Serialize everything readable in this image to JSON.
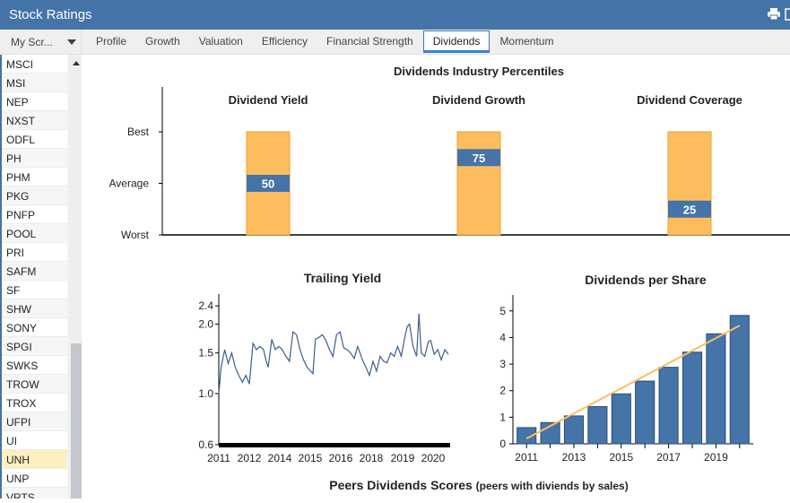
{
  "header": {
    "title": "Stock Ratings",
    "icons": [
      "print-icon",
      "window-icon"
    ]
  },
  "selector": {
    "label": "My Scr...",
    "icon": "chevron-down-icon"
  },
  "tabs": [
    {
      "label": "Profile",
      "active": false
    },
    {
      "label": "Growth",
      "active": false
    },
    {
      "label": "Valuation",
      "active": false
    },
    {
      "label": "Efficiency",
      "active": false
    },
    {
      "label": "Financial Strength",
      "active": false
    },
    {
      "label": "Dividends",
      "active": true
    },
    {
      "label": "Momentum",
      "active": false
    }
  ],
  "sidebar": {
    "items": [
      "MSCI",
      "MSI",
      "NEP",
      "NXST",
      "ODFL",
      "PH",
      "PHM",
      "PKG",
      "PNFP",
      "POOL",
      "PRI",
      "SAFM",
      "SF",
      "SHW",
      "SONY",
      "SPGI",
      "SWKS",
      "TROW",
      "TROX",
      "UFPI",
      "UI",
      "UNH",
      "UNP",
      "VRTS"
    ],
    "selected": "UNH"
  },
  "colors": {
    "brand": "#4474a8",
    "bar_fill": "#fdbd5f",
    "bar_border": "#f0a020",
    "marker": "#4474a8",
    "selected_row": "#fdf0c0",
    "trend": "#fdbd5f"
  },
  "footer": {
    "title": "Peers Dividends Scores",
    "subtitle": "(peers with diviends by sales)"
  },
  "chart_data": [
    {
      "type": "bar",
      "title": "Dividends Industry Percentiles",
      "categories": [
        "Dividend Yield",
        "Dividend Growth",
        "Dividend Coverage"
      ],
      "values": [
        50,
        75,
        25
      ],
      "yticks": [
        "Worst",
        "Average",
        "Best"
      ],
      "ylim": [
        0,
        100
      ]
    },
    {
      "type": "line",
      "title": "Trailing Yield",
      "xlabels": [
        "2011",
        "2012",
        "2014",
        "2015",
        "2016",
        "2018",
        "2019",
        "2020"
      ],
      "yticks": [
        0.6,
        1.0,
        1.5,
        2.0,
        2.4
      ],
      "ylim": [
        0.6,
        2.7
      ],
      "x": [
        2011.0,
        2011.1,
        2011.25,
        2011.4,
        2011.55,
        2011.7,
        2011.85,
        2012.0,
        2012.15,
        2012.3,
        2012.45,
        2012.6,
        2012.75,
        2012.9,
        2013.0,
        2013.1,
        2013.25,
        2013.4,
        2013.55,
        2013.7,
        2013.85,
        2014.0,
        2014.15,
        2014.3,
        2014.45,
        2014.6,
        2014.75,
        2014.9,
        2015.0,
        2015.1,
        2015.25,
        2015.4,
        2015.55,
        2015.7,
        2015.85,
        2016.0,
        2016.15,
        2016.3,
        2016.45,
        2016.6,
        2016.75,
        2016.9,
        2017.0,
        2017.1,
        2017.25,
        2017.4,
        2017.55,
        2017.7,
        2017.85,
        2018.0,
        2018.15,
        2018.3,
        2018.45,
        2018.6,
        2018.75,
        2018.9,
        2019.0,
        2019.1,
        2019.25,
        2019.4,
        2019.5,
        2019.6,
        2019.75,
        2019.9,
        2020.0,
        2020.15,
        2020.3,
        2020.45,
        2020.6,
        2020.75
      ],
      "values": [
        1.0,
        1.3,
        1.55,
        1.35,
        1.5,
        1.3,
        1.2,
        1.12,
        1.2,
        1.1,
        1.65,
        1.55,
        1.6,
        1.55,
        1.4,
        1.3,
        1.72,
        1.55,
        1.6,
        1.55,
        1.45,
        1.38,
        1.85,
        1.8,
        1.55,
        1.4,
        1.3,
        1.25,
        1.22,
        1.72,
        1.75,
        1.8,
        1.7,
        1.55,
        1.45,
        1.8,
        1.85,
        1.58,
        1.55,
        1.5,
        1.42,
        1.6,
        1.5,
        1.4,
        1.3,
        1.2,
        1.38,
        1.25,
        1.45,
        1.38,
        1.36,
        1.5,
        1.45,
        1.6,
        1.45,
        1.75,
        1.95,
        2.0,
        1.6,
        1.45,
        2.22,
        1.5,
        1.45,
        1.68,
        1.7,
        1.48,
        1.55,
        1.4,
        1.55,
        1.48
      ]
    },
    {
      "type": "bar",
      "title": "Dividends per Share",
      "categories": [
        "2011",
        "2012",
        "2013",
        "2014",
        "2015",
        "2016",
        "2017",
        "2018",
        "2019",
        "2020"
      ],
      "xlabels": [
        "2011",
        "2013",
        "2015",
        "2017",
        "2019"
      ],
      "values": [
        0.61,
        0.8,
        1.05,
        1.4,
        1.88,
        2.36,
        2.88,
        3.45,
        4.14,
        4.83
      ],
      "trendline": {
        "start": 0.2,
        "end": 4.45
      },
      "yticks": [
        0,
        1,
        2,
        3,
        4,
        5
      ],
      "ylim": [
        0,
        5.6
      ]
    }
  ]
}
